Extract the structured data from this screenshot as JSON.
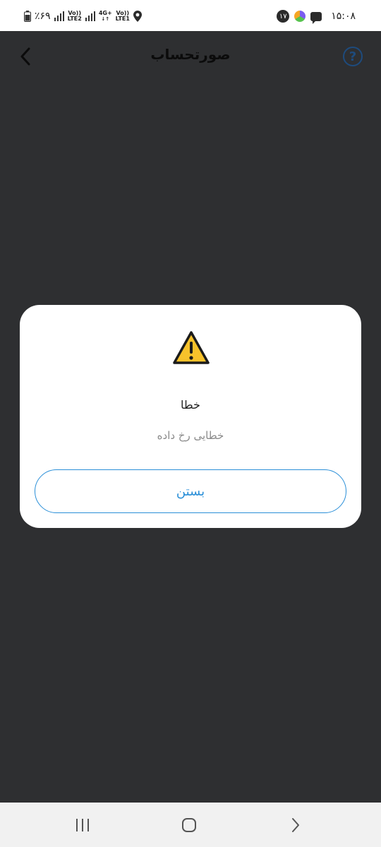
{
  "status_bar": {
    "battery_text": "٪۶۹",
    "net1_top": "Vo))",
    "net1_bottom": "LTE2",
    "net2_top": "4G+",
    "net2_mid": "Vo))",
    "net2_bottom": "LTE1",
    "notification_count": "۱۷",
    "time": "۱۵:۰۸"
  },
  "app_bar": {
    "title": "صورتحساب",
    "help_symbol": "?"
  },
  "dialog": {
    "title": "خطا",
    "message": "خطایی رخ داده",
    "close_label": "بستن"
  },
  "icons": {
    "back": "chevron-left-icon",
    "help": "question-circle-icon",
    "warning": "warning-triangle-icon",
    "recents": "recent-apps-icon",
    "home": "home-icon",
    "back_nav": "chevron-right-icon"
  },
  "colors": {
    "accent": "#2a8fd8",
    "help": "#1e4b7d",
    "warning": "#f7c22b",
    "overlay": "#2e2f31"
  }
}
